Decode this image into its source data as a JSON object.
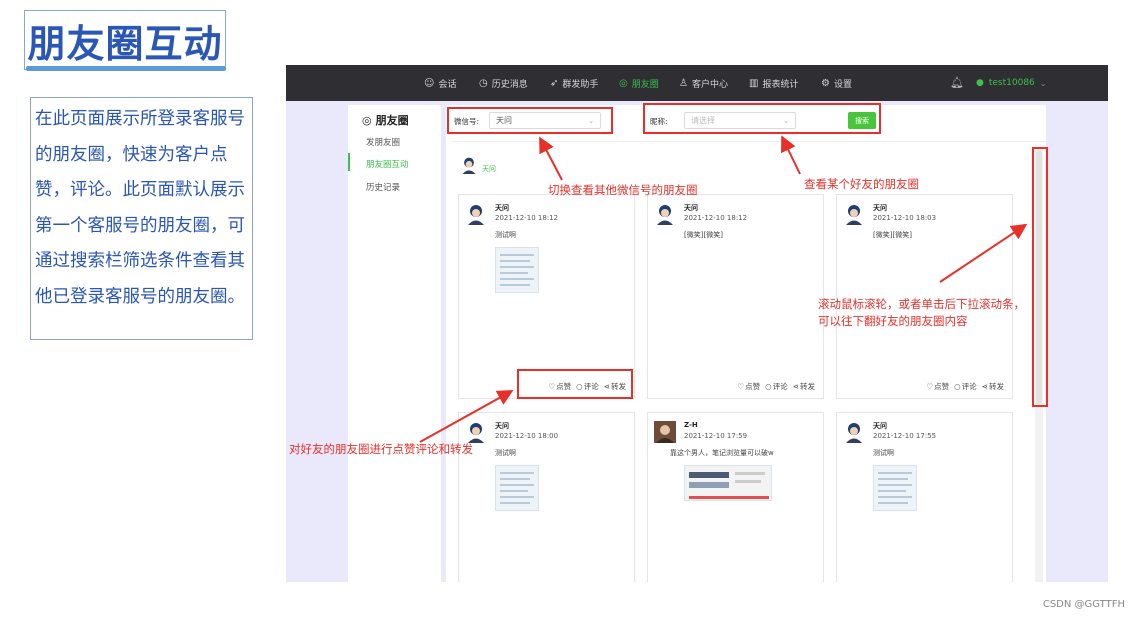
{
  "slide": {
    "title": "朋友圈互动",
    "description": "在此页面展示所登录客服号的朋友圈，快速为客户点赞，评论。此页面默认展示第一个客服号的朋友圈，可通过搜索栏筛选条件查看其他已登录客服号的朋友圈。"
  },
  "nav": {
    "items": [
      {
        "label": "会话",
        "icon": "chat-icon"
      },
      {
        "label": "历史消息",
        "icon": "clock-icon"
      },
      {
        "label": "群发助手",
        "icon": "send-icon"
      },
      {
        "label": "朋友圈",
        "icon": "moments-icon",
        "active": true
      },
      {
        "label": "客户中心",
        "icon": "user-icon"
      },
      {
        "label": "报表统计",
        "icon": "chart-icon"
      },
      {
        "label": "设置",
        "icon": "gear-icon"
      }
    ],
    "user": "test10086"
  },
  "sidebar": {
    "title": "朋友圈",
    "items": [
      "发朋友圈",
      "朋友圈互动",
      "历史记录"
    ],
    "active": "朋友圈互动"
  },
  "filter": {
    "wechat_label": "微信号:",
    "wechat_value": "天问",
    "nickname_label": "昵称:",
    "nickname_placeholder": "请选择",
    "search_label": "搜索"
  },
  "feed": {
    "owner_name": "天问",
    "actions": {
      "like": "点赞",
      "comment": "评论",
      "forward": "转发"
    },
    "posts": [
      {
        "name": "天问",
        "time": "2021-12-10 18:12",
        "text": "测试啊",
        "image": "screenshot"
      },
      {
        "name": "天问",
        "time": "2021-12-10 18:12",
        "text": "[微笑][微笑]",
        "image": ""
      },
      {
        "name": "天问",
        "time": "2021-12-10 18:03",
        "text": "[微笑][微笑]",
        "image": ""
      },
      {
        "name": "天问",
        "time": "2021-12-10 18:00",
        "text": "测试啊",
        "image": "screenshot"
      },
      {
        "name": "Z-H",
        "time": "2021-12-10 17:59",
        "text": "靠这个男人，笔记浏览量可以破w",
        "image": "wide"
      },
      {
        "name": "天问",
        "time": "2021-12-10 17:55",
        "text": "测试啊",
        "image": "screenshot"
      }
    ]
  },
  "annotations": {
    "switch_wechat": "切换查看其他微信号的朋友圈",
    "view_friend": "查看某个好友的朋友圈",
    "scroll_line1": "滚动鼠标滚轮，或者单击后下拉滚动条，",
    "scroll_line2": "可以往下翻好友的朋友圈内容",
    "interact": "对好友的朋友圈进行点赞评论和转发",
    "color": "#e8302a"
  },
  "footer": "CSDN @GGTTFH"
}
